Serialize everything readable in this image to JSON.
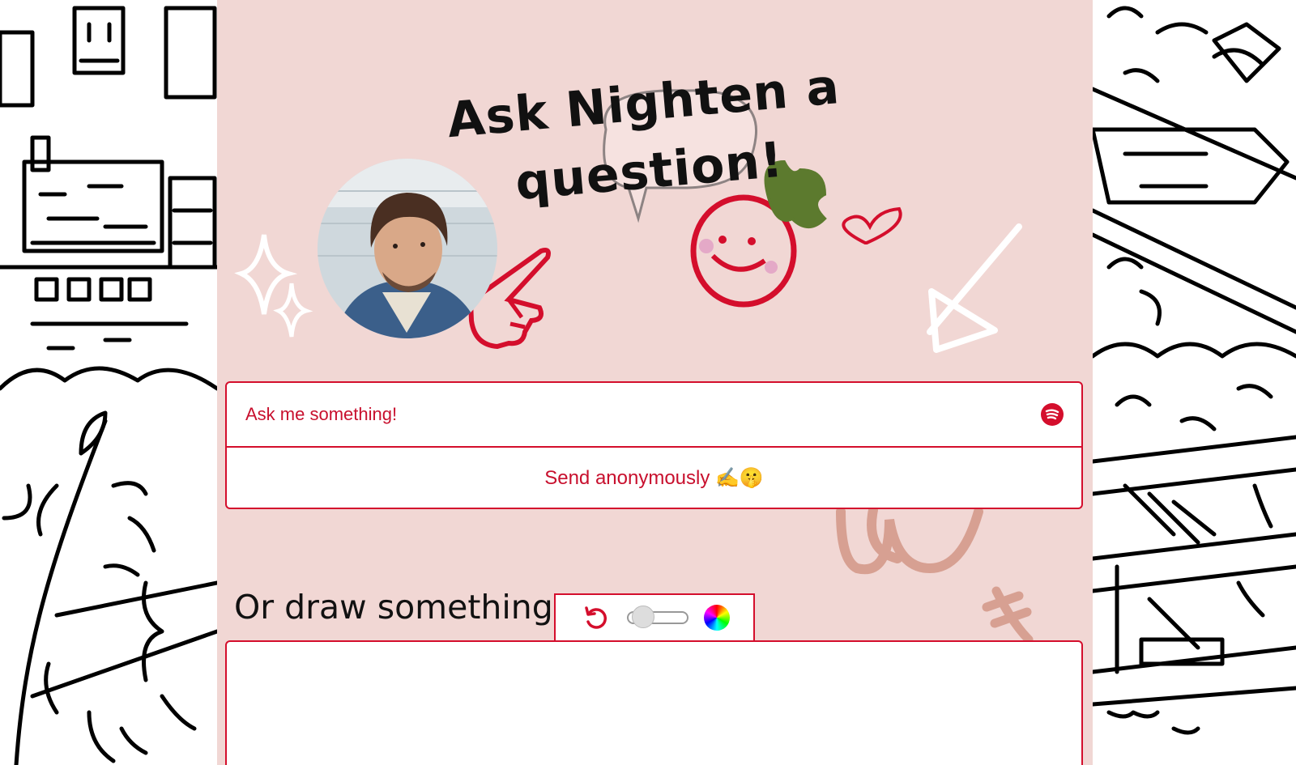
{
  "header": {
    "title": "Ask Nighten a question!"
  },
  "avatar": {
    "alt": "Nighten profile photo"
  },
  "question_form": {
    "placeholder": "Ask me something!",
    "send_label": "Send anonymously ✍️🤫",
    "music_icon": "spotify-icon"
  },
  "drawing": {
    "heading": "Or draw something!",
    "tools": {
      "undo_icon": "undo-icon",
      "brush_size": 0.1,
      "color_icon": "color-wheel-icon"
    }
  },
  "colors": {
    "accent": "#d40e2c",
    "panel_background": "#f1d7d4",
    "text": "#111111"
  }
}
